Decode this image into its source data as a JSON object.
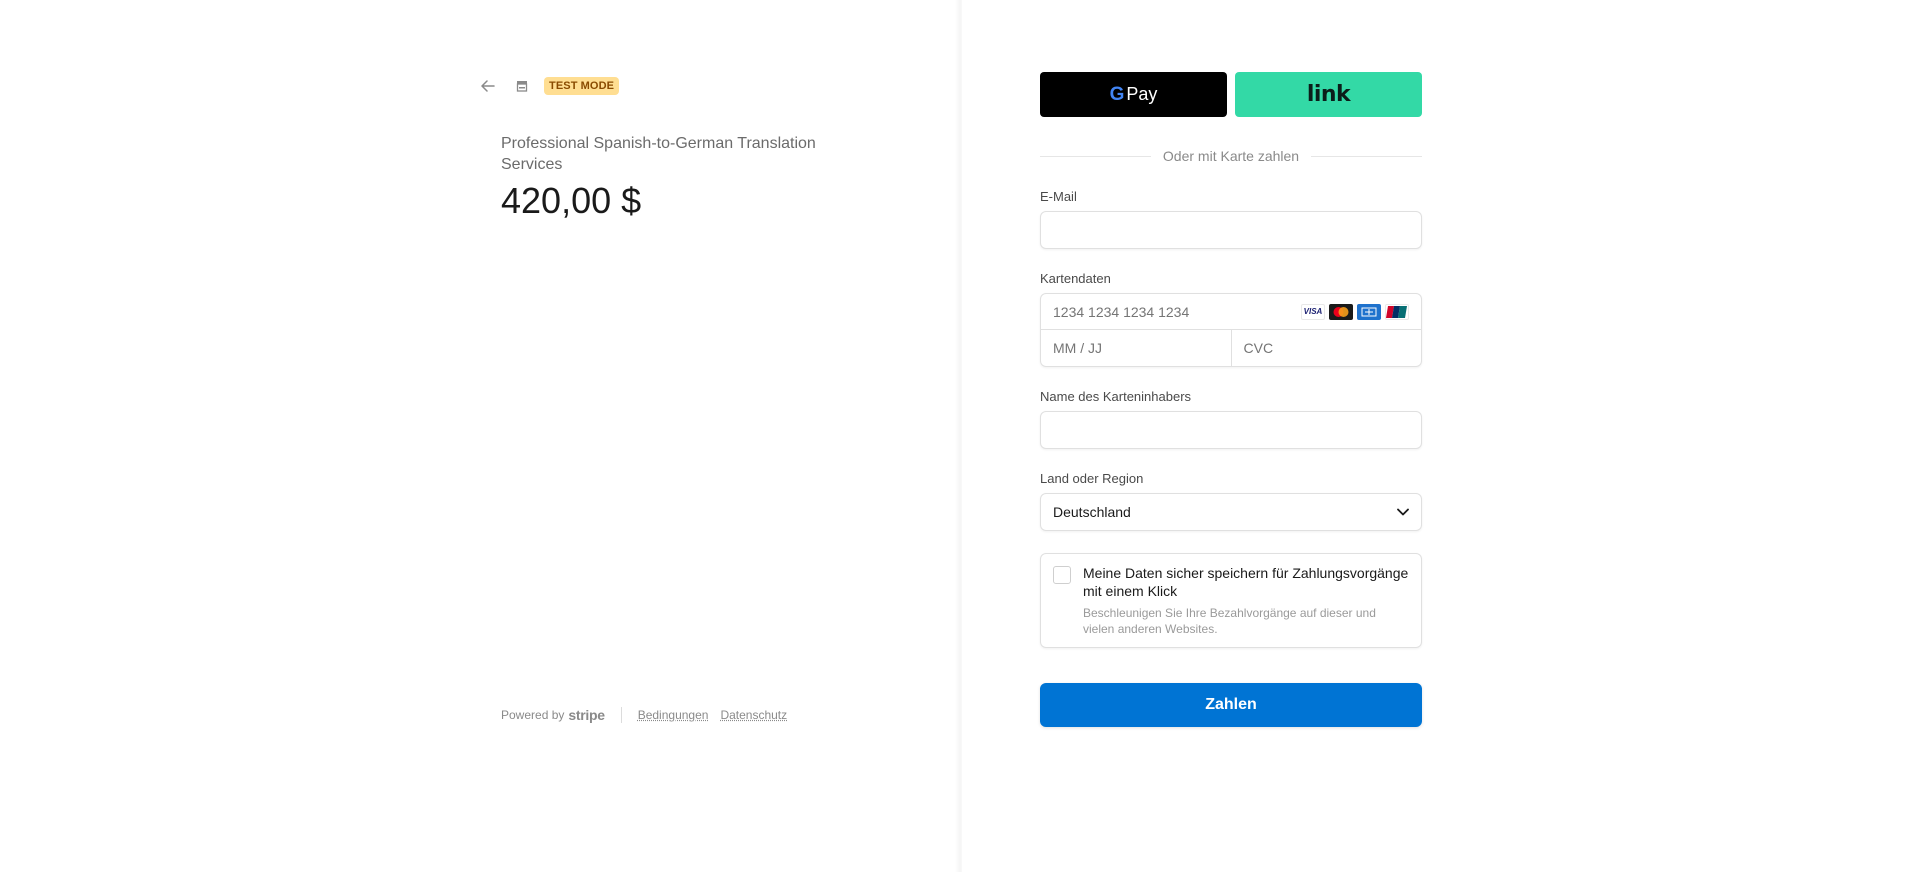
{
  "header": {
    "back_icon": "arrow-left-icon",
    "store_icon": "store-icon",
    "badge": "TEST MODE",
    "badge_color": "#ffde92"
  },
  "product": {
    "name": "Professional Spanish-to-German Translation Services",
    "price": "420,00 $"
  },
  "footer": {
    "powered_by": "Powered by",
    "brand": "stripe",
    "links": [
      "Bedingungen",
      "Datenschutz"
    ]
  },
  "wallets": {
    "gpay_g": "G",
    "gpay_label": "Pay",
    "link_label": "link",
    "link_color": "#33d9a6"
  },
  "separator": "Oder mit Karte zahlen",
  "form": {
    "email_label": "E-Mail",
    "email_value": "",
    "card_label": "Kartendaten",
    "card_number_placeholder": "1234 1234 1234 1234",
    "card_brands": [
      "visa-icon",
      "mastercard-icon",
      "amex-icon",
      "unionpay-icon"
    ],
    "expiry_placeholder": "MM / JJ",
    "cvc_placeholder": "CVC",
    "name_label": "Name des Karteninhabers",
    "name_value": "",
    "country_label": "Land oder Region",
    "country_value": "Deutschland"
  },
  "save": {
    "title": "Meine Daten sicher speichern für Zahlungsvorgänge mit einem Klick",
    "subtitle": "Beschleunigen Sie Ihre Bezahlvorgänge auf dieser und vielen anderen Websites.",
    "checked": false
  },
  "pay_button": {
    "label": "Zahlen",
    "color": "#0074d4"
  }
}
